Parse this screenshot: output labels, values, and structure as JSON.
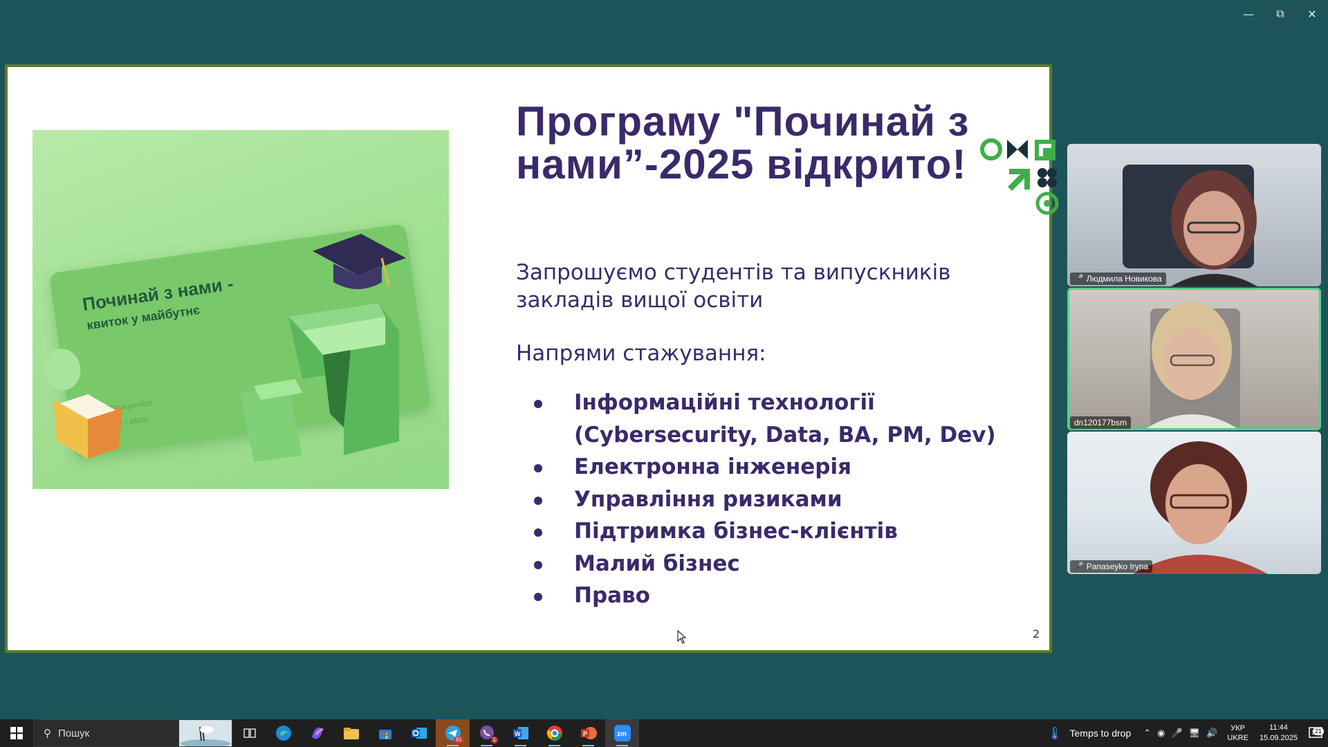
{
  "window": {
    "minimize_icon": "minimize-icon",
    "restore_icon": "restore-icon",
    "close_icon": "close-icon"
  },
  "slide": {
    "title": "Програму \"Починай з нами”-2025 відкрито!",
    "intro": " Запрошуємо студентів та випускників закладів вищої освіти",
    "directions_label": "Напрями стажування:",
    "directions": [
      "Інформаційні технології (Cybersecurity, Data, BA, PM, Dev)",
      "Електронна інженерія",
      "Управління ризиками",
      "Підтримка бізнес-клієнтів",
      "Малий бізнес",
      "Право"
    ],
    "page_number": "2",
    "image": {
      "ticket_title": "Починай з нами -",
      "ticket_subtitle": "квиток у майбутнє",
      "ticket_meta_1": "Приєднуйся",
      "ticket_meta_2": "Тут і зараз"
    }
  },
  "participants": [
    {
      "name": "Людмила Новикова",
      "muted": true,
      "active": false
    },
    {
      "name": "dn120177bsm",
      "muted": false,
      "active": true
    },
    {
      "name": "Panaseyko Iryna",
      "muted": true,
      "active": false
    }
  ],
  "taskbar": {
    "search_placeholder": "Пошук",
    "weather_text": "Temps to drop",
    "language_line1": "УКР",
    "language_line2": "UKRE",
    "time": "11:44",
    "date": "15.09.2025",
    "notification_count": "21",
    "telegram_badge": "61",
    "viber_badge": "1",
    "apps": [
      "task-view",
      "edge",
      "copilot",
      "file-explorer",
      "microsoft-store",
      "outlook",
      "telegram",
      "viber",
      "word",
      "chrome",
      "powerpoint",
      "zoom"
    ]
  },
  "colors": {
    "desktop_bg": "#1d5459",
    "slide_border": "#5a7d2e",
    "text_primary": "#3a2a6a",
    "brand_green": "#3fae49",
    "active_speaker": "#4fd18b"
  }
}
